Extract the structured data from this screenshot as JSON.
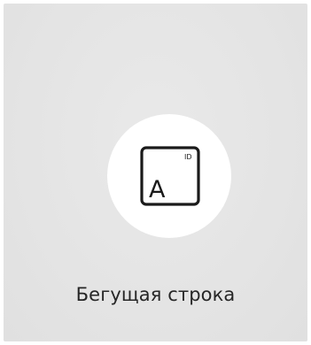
{
  "tile": {
    "label": "Бегущая строка",
    "icon": {
      "name": "ticker-id-icon",
      "main_letter": "A",
      "badge_text": "ID"
    }
  },
  "colors": {
    "tile_background": "#e4e4e4",
    "circle": "#ffffff",
    "icon_stroke": "#1a1a1a",
    "label_text": "#262626"
  }
}
